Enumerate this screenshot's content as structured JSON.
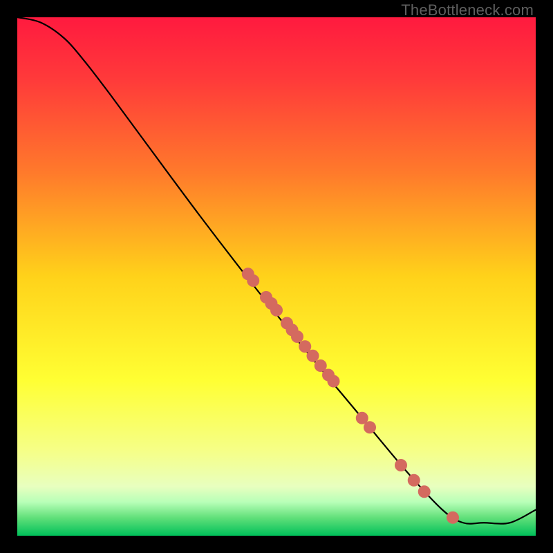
{
  "watermark": "TheBottleneck.com",
  "chart_data": {
    "type": "line",
    "title": "",
    "xlabel": "",
    "ylabel": "",
    "xlim": [
      0,
      100
    ],
    "ylim": [
      0,
      100
    ],
    "background": {
      "style": "vertical-gradient",
      "stops": [
        {
          "pos": 0.0,
          "color": "#ff1a3f"
        },
        {
          "pos": 0.12,
          "color": "#ff3a3a"
        },
        {
          "pos": 0.3,
          "color": "#ff7a2b"
        },
        {
          "pos": 0.5,
          "color": "#ffd21a"
        },
        {
          "pos": 0.7,
          "color": "#ffff33"
        },
        {
          "pos": 0.84,
          "color": "#f5ff8a"
        },
        {
          "pos": 0.905,
          "color": "#e8ffbf"
        },
        {
          "pos": 0.935,
          "color": "#b8ffb8"
        },
        {
          "pos": 0.965,
          "color": "#62e07a"
        },
        {
          "pos": 1.0,
          "color": "#00c05a"
        }
      ]
    },
    "series": [
      {
        "name": "bottleneck-curve",
        "points": [
          {
            "x": 0.0,
            "y": 100.0
          },
          {
            "x": 4.5,
            "y": 99.0
          },
          {
            "x": 9.0,
            "y": 96.0
          },
          {
            "x": 13.0,
            "y": 91.5
          },
          {
            "x": 18.0,
            "y": 85.0
          },
          {
            "x": 25.0,
            "y": 75.5
          },
          {
            "x": 35.0,
            "y": 62.0
          },
          {
            "x": 45.0,
            "y": 49.0
          },
          {
            "x": 55.0,
            "y": 36.5
          },
          {
            "x": 65.0,
            "y": 24.5
          },
          {
            "x": 75.0,
            "y": 12.5
          },
          {
            "x": 82.0,
            "y": 5.0
          },
          {
            "x": 86.0,
            "y": 2.5
          },
          {
            "x": 90.0,
            "y": 2.5
          },
          {
            "x": 95.0,
            "y": 2.5
          },
          {
            "x": 100.0,
            "y": 5.0
          }
        ]
      }
    ],
    "scatter": {
      "name": "sample-markers",
      "color": "#d46a5f",
      "radius": 9,
      "points": [
        {
          "x": 44.5,
          "y": 50.5
        },
        {
          "x": 45.5,
          "y": 49.2
        },
        {
          "x": 48.0,
          "y": 46.0
        },
        {
          "x": 49.0,
          "y": 44.8
        },
        {
          "x": 50.0,
          "y": 43.5
        },
        {
          "x": 52.0,
          "y": 41.0
        },
        {
          "x": 53.0,
          "y": 39.7
        },
        {
          "x": 54.0,
          "y": 38.4
        },
        {
          "x": 55.5,
          "y": 36.5
        },
        {
          "x": 57.0,
          "y": 34.7
        },
        {
          "x": 58.5,
          "y": 32.8
        },
        {
          "x": 60.0,
          "y": 31.0
        },
        {
          "x": 61.0,
          "y": 29.8
        },
        {
          "x": 66.5,
          "y": 22.7
        },
        {
          "x": 68.0,
          "y": 20.9
        },
        {
          "x": 74.0,
          "y": 13.6
        },
        {
          "x": 76.5,
          "y": 10.7
        },
        {
          "x": 78.5,
          "y": 8.5
        },
        {
          "x": 84.0,
          "y": 3.5
        }
      ]
    }
  }
}
